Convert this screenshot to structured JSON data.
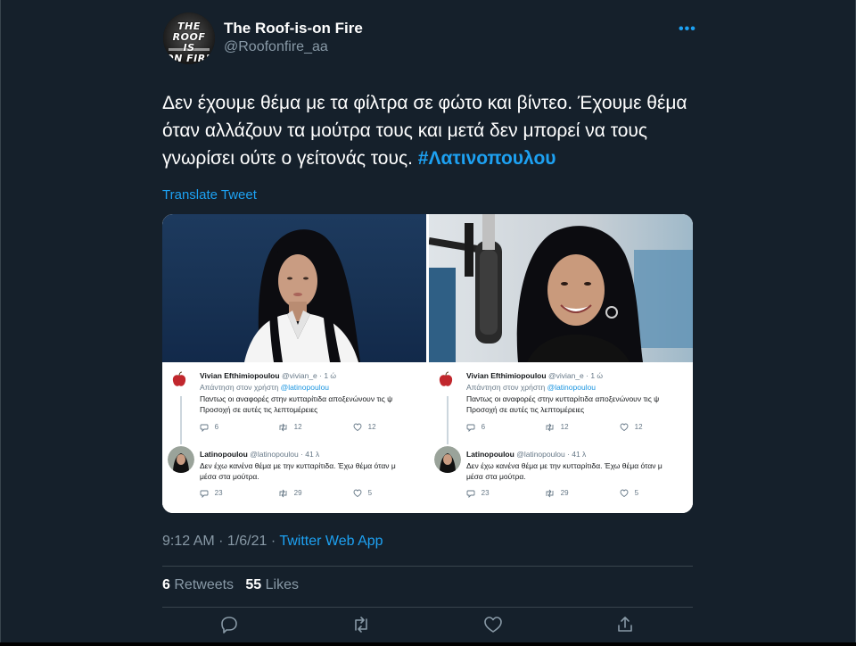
{
  "author": {
    "avatar_text": [
      "THE ROOF",
      "IS",
      "ON FIRE"
    ],
    "display_name": "The Roof-is-on Fire",
    "handle": "@Roofonfire_aa"
  },
  "more_icon": "more-horizontal-icon",
  "tweet": {
    "text": "Δεν έχουμε θέμα με τα φίλτρα σε φώτο και βίντεο. Έχουμε θέμα όταν αλλάζουν τα μούτρα τους και μετά δεν μπορεί να τους γνωρίσει ούτε ο γείτονάς τους.",
    "hashtag": "#Λατινοπουλου",
    "translate_label": "Translate Tweet"
  },
  "media": {
    "panels": [
      {
        "reply": {
          "name": "Vivian Efthimiopoulou",
          "meta": "@vivian_e · 1 ώ",
          "replying_prefix": "Απάντηση στον χρήστη",
          "replying_to": "@latinopoulou",
          "body_line1": "Παντως οι αναφορές στην κυτταρίτιδα αποξενώνουν τις ψ",
          "body_line2": "Προσοχή σε αυτές τις λεπτομέρειες",
          "stats": {
            "replies": "6",
            "retweets": "12",
            "likes": "12"
          }
        },
        "quote": {
          "name": "Latinopoulou",
          "meta": "@latinopoulou · 41 λ",
          "body_line1": "Δεν έχω κανένα θέμα με την κυτταρίτιδα. Έχω θέμα όταν μ",
          "body_line2": "μέσα στα μούτρα.",
          "stats": {
            "replies": "23",
            "retweets": "29",
            "likes": "5"
          }
        }
      },
      {
        "reply": {
          "name": "Vivian Efthimiopoulou",
          "meta": "@vivian_e · 1 ώ",
          "replying_prefix": "Απάντηση στον χρήστη",
          "replying_to": "@latinopoulou",
          "body_line1": "Παντως οι αναφορές στην κυτταρίτιδα αποξενώνουν τις ψ",
          "body_line2": "Προσοχή σε αυτές τις λεπτομέρειες",
          "stats": {
            "replies": "6",
            "retweets": "12",
            "likes": "12"
          }
        },
        "quote": {
          "name": "Latinopoulou",
          "meta": "@latinopoulou · 41 λ",
          "body_line1": "Δεν έχω κανένα θέμα με την κυτταρίτιδα. Έχω θέμα όταν μ",
          "body_line2": "μέσα στα μούτρα.",
          "stats": {
            "replies": "23",
            "retweets": "29",
            "likes": "5"
          }
        }
      }
    ]
  },
  "meta": {
    "time": "9:12 AM",
    "separator": " · ",
    "date": "1/6/21",
    "app": "Twitter Web App"
  },
  "engagement": {
    "retweets_count": "6",
    "retweets_label": "Retweets",
    "likes_count": "55",
    "likes_label": "Likes"
  },
  "actions": [
    "reply-icon",
    "retweet-icon",
    "like-icon",
    "share-icon"
  ],
  "colors": {
    "background": "#15202b",
    "accent": "#1da1f2",
    "secondary_text": "#8899a6",
    "border": "#38444d"
  }
}
